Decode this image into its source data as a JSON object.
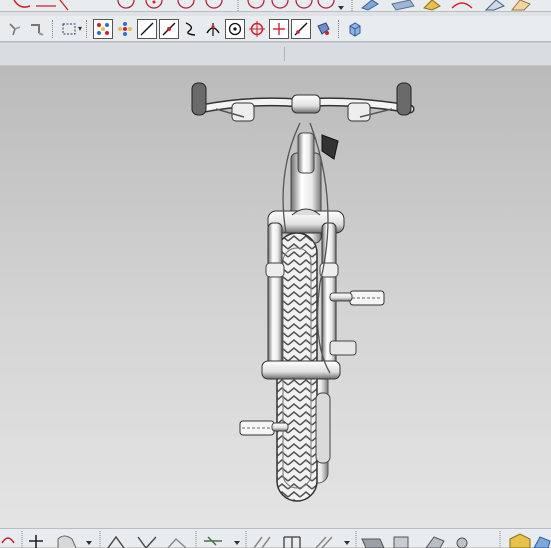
{
  "window": {
    "title": ""
  },
  "toolbars": {
    "top": [
      "arc-icon",
      "circle-icon",
      "circle-icon",
      "circle-icon",
      "sketch-icon",
      "curve-icon",
      "surface-icon",
      "fillet-icon",
      "view-icon"
    ],
    "second": [
      "snap-point-icon",
      "snap-arrow-icon",
      "selection-box-icon",
      "snap-end-icon",
      "snap-mid-icon",
      "line-icon",
      "line-point-icon",
      "curve-tangent-icon",
      "intersection-icon",
      "center-icon",
      "quadrant-icon",
      "point-cross-icon",
      "point-on-curve-icon",
      "face-icon",
      "solid-icon"
    ],
    "bottom": [
      "curve-icon",
      "plus-icon",
      "extrude-icon",
      "trim-icon",
      "line-icon",
      "fillet-icon",
      "pattern-icon",
      "transform-icon",
      "mirror-icon",
      "offset-icon",
      "section-icon",
      "box-icon",
      "analysis-icon",
      "shaded-cube-icon"
    ]
  },
  "viewport": {
    "model": "bicycle-front-view",
    "background_top": "#b8b8b8",
    "background_bottom": "#e4e4e4"
  },
  "colors": {
    "accent_red": "#d0202a",
    "accent_blue": "#2d6fd6"
  }
}
